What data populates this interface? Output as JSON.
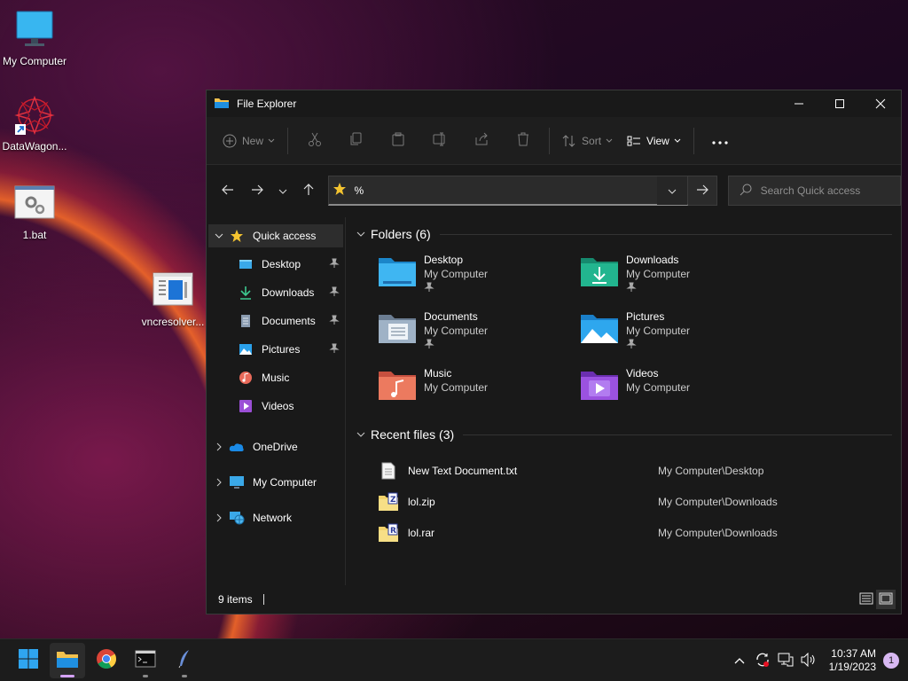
{
  "desktop": {
    "icons": [
      {
        "label": "My Computer"
      },
      {
        "label": "DataWagon..."
      },
      {
        "label": "1.bat"
      },
      {
        "label": "vncresolver..."
      }
    ]
  },
  "window": {
    "title": "File Explorer",
    "toolbar": {
      "new_label": "New",
      "sort_label": "Sort",
      "view_label": "View"
    },
    "address": {
      "value": "%"
    },
    "search": {
      "placeholder": "Search Quick access"
    },
    "sidebar": {
      "quick_access": "Quick access",
      "items": [
        {
          "label": "Desktop",
          "pinned": true
        },
        {
          "label": "Downloads",
          "pinned": true
        },
        {
          "label": "Documents",
          "pinned": true
        },
        {
          "label": "Pictures",
          "pinned": true
        },
        {
          "label": "Music",
          "pinned": false
        },
        {
          "label": "Videos",
          "pinned": false
        }
      ],
      "roots": [
        {
          "label": "OneDrive"
        },
        {
          "label": "My Computer"
        },
        {
          "label": "Network"
        }
      ]
    },
    "folders_section": "Folders (6)",
    "folders": [
      {
        "name": "Desktop",
        "location": "My Computer",
        "pinned": true
      },
      {
        "name": "Downloads",
        "location": "My Computer",
        "pinned": true
      },
      {
        "name": "Documents",
        "location": "My Computer",
        "pinned": true
      },
      {
        "name": "Pictures",
        "location": "My Computer",
        "pinned": true
      },
      {
        "name": "Music",
        "location": "My Computer",
        "pinned": false
      },
      {
        "name": "Videos",
        "location": "My Computer",
        "pinned": false
      }
    ],
    "recent_section": "Recent files (3)",
    "recent_files": [
      {
        "name": "New Text Document.txt",
        "path": "My Computer\\Desktop"
      },
      {
        "name": "lol.zip",
        "path": "My Computer\\Downloads"
      },
      {
        "name": "lol.rar",
        "path": "My Computer\\Downloads"
      }
    ],
    "status": {
      "items": "9 items"
    }
  },
  "taskbar": {
    "time": "10:37 AM",
    "date": "1/19/2023",
    "notifications": "1"
  },
  "colors": {
    "accent": "#d6a2ff",
    "window_bg": "#191919",
    "folder_blue": "#29a6e6",
    "folder_green": "#1fa888"
  }
}
